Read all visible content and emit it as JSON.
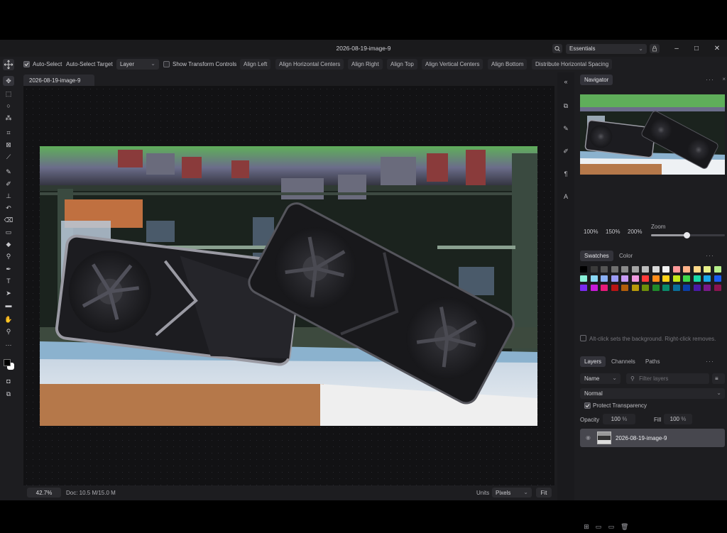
{
  "window": {
    "title": "2026-08-19-image-9",
    "workspace": "Essentials",
    "controls": [
      "–",
      "□",
      "✕"
    ]
  },
  "options_bar": {
    "auto_select_label": "Auto-Select",
    "auto_select_target_label": "Auto-Select Target",
    "target_value": "Layer",
    "show_transform_label": "Show Transform Controls",
    "align_buttons": [
      "Align Left",
      "Align Horizontal Centers",
      "Align Right",
      "Align Top",
      "Align Vertical Centers",
      "Align Bottom",
      "Distribute Horizontal Spacing"
    ]
  },
  "document": {
    "tab_name": "2026-08-19-image-9"
  },
  "status_bar": {
    "zoom": "42.7%",
    "doc_info": "Doc: 10.5 M/15.0 M",
    "units_label": "Units",
    "units_value": "Pixels",
    "fit_label": "Fit"
  },
  "navigator": {
    "tab": "Navigator",
    "zoom_presets": [
      "100%",
      "150%",
      "200%"
    ],
    "zoom_label": "Zoom",
    "zoom_level": 0.48
  },
  "swatches": {
    "tabs": [
      "Swatches",
      "Color"
    ],
    "hint": "Alt-click sets the background. Right-click removes.",
    "rows": [
      [
        "#000000",
        "#3a3a3a",
        "#555555",
        "#6f6f6f",
        "#8a8a8a",
        "#a4a4a4",
        "#bdbdbd",
        "#d8d8d8",
        "#f2f2f2",
        "#ff9a9a",
        "#ffb38a",
        "#ffd98a",
        "#e8f08a",
        "#b5ef8a"
      ],
      [
        "#8af0d8",
        "#8ad7f5",
        "#8ab0f5",
        "#9a9af5",
        "#c79af5",
        "#f09ae0",
        "#ff3b3b",
        "#ff8c1a",
        "#ffd21a",
        "#c6e81a",
        "#3fd94a",
        "#1ad9a8",
        "#1aa8e8",
        "#1a5cf0"
      ],
      [
        "#7a2bf0",
        "#c61ad9",
        "#e81a7a",
        "#b81414",
        "#b35e0a",
        "#b89a0a",
        "#6f8f0a",
        "#1f8a2a",
        "#0a8a6a",
        "#0a6f9a",
        "#0a3fa8",
        "#4a1aa8",
        "#7a1a8a",
        "#8a1450"
      ]
    ]
  },
  "layers": {
    "tabs": [
      "Layers",
      "Channels",
      "Paths"
    ],
    "sort": "Name",
    "filter_placeholder": "Filter layers",
    "blend_mode": "Normal",
    "protect_label": "Protect Transparency",
    "opacity_label": "Opacity",
    "opacity_value": "100",
    "opacity_unit": "%",
    "fill_label": "Fill",
    "fill_value": "100",
    "fill_unit": "%",
    "items": [
      {
        "name": "2026-08-19-image-9",
        "visible": true
      }
    ]
  },
  "toolbar_icons": [
    "move-icon",
    "marquee-icon",
    "lasso-icon",
    "magic-wand-icon",
    "crop-icon",
    "frame-icon",
    "eyedropper-icon",
    "healing-icon",
    "brush-icon",
    "stamp-icon",
    "history-brush-icon",
    "eraser-icon",
    "gradient-icon",
    "blur-icon",
    "dodge-icon",
    "pen-icon",
    "type-icon",
    "path-select-icon",
    "rectangle-icon",
    "hand-icon",
    "zoom-icon",
    "more-tools-icon"
  ]
}
